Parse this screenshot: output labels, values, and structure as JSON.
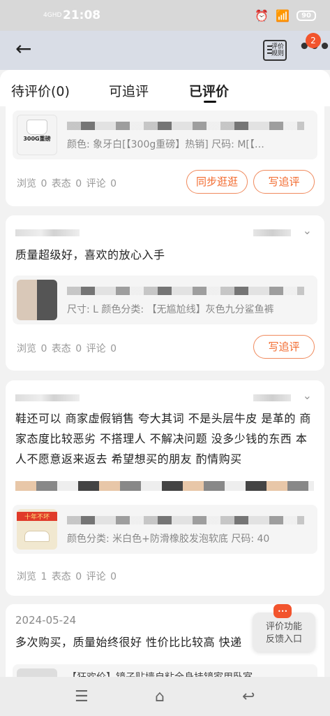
{
  "status_bar": {
    "network": "4GHD",
    "time": "21:08",
    "battery": "90"
  },
  "header": {
    "rules_label": "评价\n规则",
    "notification_count": "2"
  },
  "tabs": [
    {
      "label": "待评价(0)",
      "active": false
    },
    {
      "label": "可追评",
      "active": false
    },
    {
      "label": "已评价",
      "active": true
    }
  ],
  "cards": [
    {
      "review": "",
      "thumb_text": "300G重磅",
      "spec": "颜色: 象牙白[【300g重磅】热销] 尺码: M[【…",
      "stats": {
        "views": "浏览 0",
        "likes": "表态 0",
        "comments": "评论 0"
      },
      "buttons": [
        "同步逛逛",
        "写追评"
      ]
    },
    {
      "review": "质量超级好，喜欢的放心入手",
      "spec": "尺寸: L 颜色分类: 【无尴尬线】灰色九分鲨鱼裤",
      "stats": {
        "views": "浏览 0",
        "likes": "表态 0",
        "comments": "评论 0"
      },
      "buttons": [
        "写追评"
      ]
    },
    {
      "review": "鞋还可以 商家虚假销售 夸大其词 不是头层牛皮 是革的 商家态度比较恶劣 不搭理人 不解决问题 没多少钱的东西 本人不愿意返来返去 希望想买的朋友 酌情购买",
      "thumb_text": "十年不坏",
      "spec": "颜色分类: 米白色+防滑橡胶发泡软底 尺码: 40",
      "stats": {
        "views": "浏览 1",
        "likes": "表态 0",
        "comments": "评论 0"
      },
      "buttons": []
    },
    {
      "date": "2024-05-24",
      "review": "多次购买，质量始终很好 性价比比较高 快递",
      "spec": "【狂欢价】镜子贴墙自粘全身挂镜家用卧室"
    }
  ],
  "feedback": {
    "line1": "评价功能",
    "line2": "反馈入口"
  },
  "colors": {
    "accent": "#f26a2e",
    "badge": "#f2542d",
    "header_bg": "#d9dde6"
  }
}
